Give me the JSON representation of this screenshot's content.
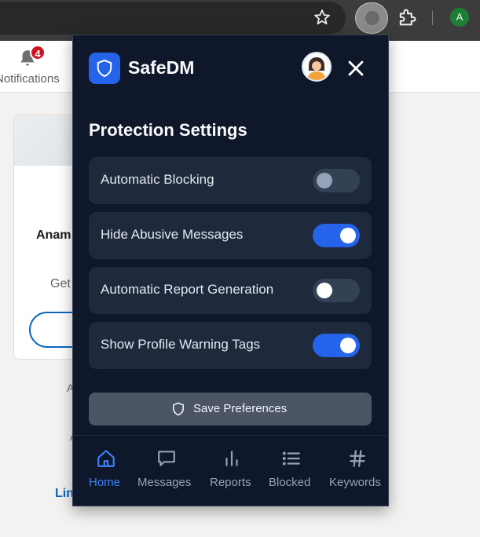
{
  "browser": {
    "profile_initial": "A",
    "star_icon": "star-icon",
    "extensions_icon": "puzzle-icon"
  },
  "background_page": {
    "notifications_label": "Notifications",
    "notifications_count": "4",
    "card_name": "Anam",
    "card_sub": "Get",
    "text_a1": "A",
    "text_a2": "A",
    "link_text": "Lin"
  },
  "popup": {
    "app_name": "SafeDM",
    "section_title": "Protection Settings",
    "settings": [
      {
        "label": "Automatic Blocking",
        "enabled": false
      },
      {
        "label": "Hide Abusive Messages",
        "enabled": true
      },
      {
        "label": "Automatic Report Generation",
        "enabled": false
      },
      {
        "label": "Show Profile Warning Tags",
        "enabled": true
      }
    ],
    "save_label": "Save Preferences",
    "nav": [
      {
        "label": "Home",
        "icon": "home-icon",
        "active": true
      },
      {
        "label": "Messages",
        "icon": "message-icon",
        "active": false
      },
      {
        "label": "Reports",
        "icon": "bar-chart-icon",
        "active": false
      },
      {
        "label": "Blocked",
        "icon": "list-icon",
        "active": false
      },
      {
        "label": "Keywords",
        "icon": "hash-icon",
        "active": false
      }
    ]
  },
  "colors": {
    "accent": "#2563eb",
    "popup_bg": "#0f172a",
    "row_bg": "#1e293b",
    "active_nav": "#3b82f6",
    "inactive_nav": "#94a3b8"
  }
}
